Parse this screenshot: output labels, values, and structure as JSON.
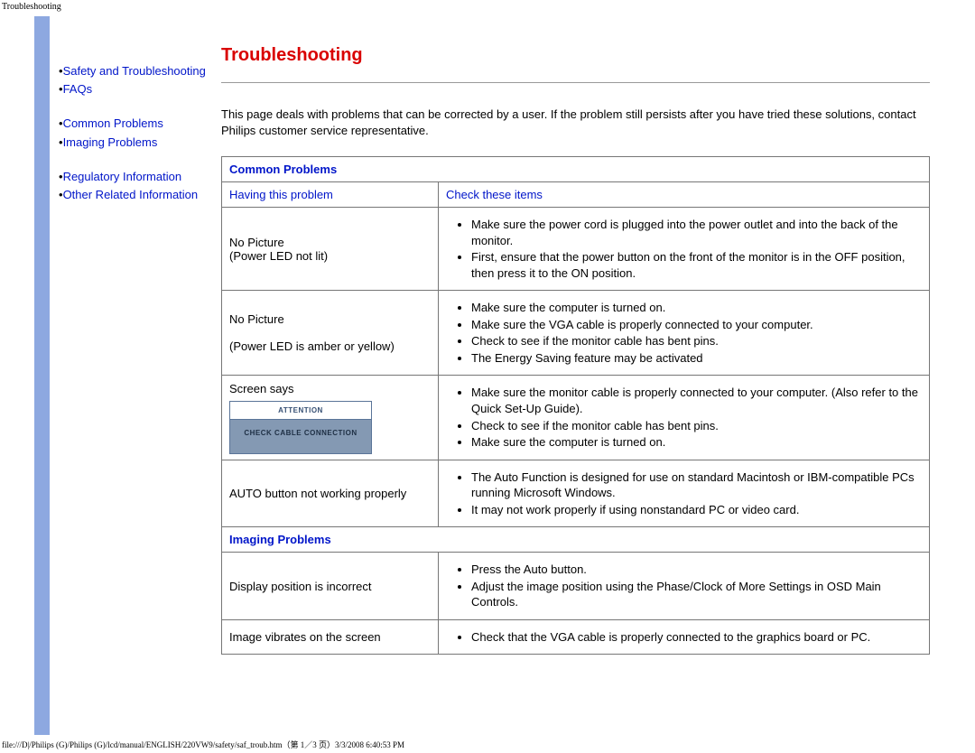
{
  "topLabel": "Troubleshooting",
  "footer": "file:///D|/Philips (G)/Philips (G)/lcd/manual/ENGLISH/220VW9/safety/saf_troub.htm（第 1／3 页）3/3/2008 6:40:53 PM",
  "sidebar": {
    "links": [
      {
        "label": "Safety and Troubleshooting"
      },
      {
        "label": "FAQs"
      },
      {
        "label": "Common Problems"
      },
      {
        "label": "Imaging Problems"
      },
      {
        "label": "Regulatory Information"
      },
      {
        "label": "Other Related Information"
      }
    ]
  },
  "title": "Troubleshooting",
  "intro": "This page deals with problems that can be corrected by a user. If the problem still persists after you have tried these solutions, contact Philips customer service representative.",
  "sections": {
    "common": {
      "header": "Common Problems",
      "colLeft": "Having this problem",
      "colRight": "Check these items",
      "rows": [
        {
          "problemLines": [
            "No Picture",
            "(Power LED not lit)"
          ],
          "checks": [
            "Make sure the power cord is plugged into the power outlet and into the back of the monitor.",
            "First, ensure that the power button on the front of the monitor is in the OFF position, then press it to the ON position."
          ]
        },
        {
          "problemLines": [
            "No Picture",
            "",
            "(Power LED is amber or yellow)"
          ],
          "checks": [
            "Make sure the computer is turned on.",
            "Make sure the VGA cable is properly connected to your computer.",
            "Check to see if the monitor cable has bent pins.",
            "The Energy Saving feature may be activated"
          ]
        },
        {
          "problemLines": [
            "Screen says"
          ],
          "screenBox": {
            "attention": "ATTENTION",
            "msg": "CHECK CABLE CONNECTION"
          },
          "checks": [
            "Make sure the monitor cable is properly connected to your computer. (Also refer to the Quick Set-Up Guide).",
            "Check to see if the monitor cable has bent pins.",
            "Make sure the computer is turned on."
          ]
        },
        {
          "problemLines": [
            "AUTO button not working properly"
          ],
          "checks": [
            "The Auto Function is designed for use on standard Macintosh or IBM-compatible PCs running Microsoft Windows.",
            "It may not work properly if using nonstandard PC or video card."
          ]
        }
      ]
    },
    "imaging": {
      "header": "Imaging Problems",
      "rows": [
        {
          "problemLines": [
            "Display position is incorrect"
          ],
          "checks": [
            "Press the Auto button.",
            "Adjust the image position using the Phase/Clock of More Settings in OSD Main Controls."
          ]
        },
        {
          "problemLines": [
            "Image vibrates on the screen"
          ],
          "checks": [
            "Check that the VGA cable is properly connected to the graphics board or PC."
          ]
        }
      ]
    }
  }
}
